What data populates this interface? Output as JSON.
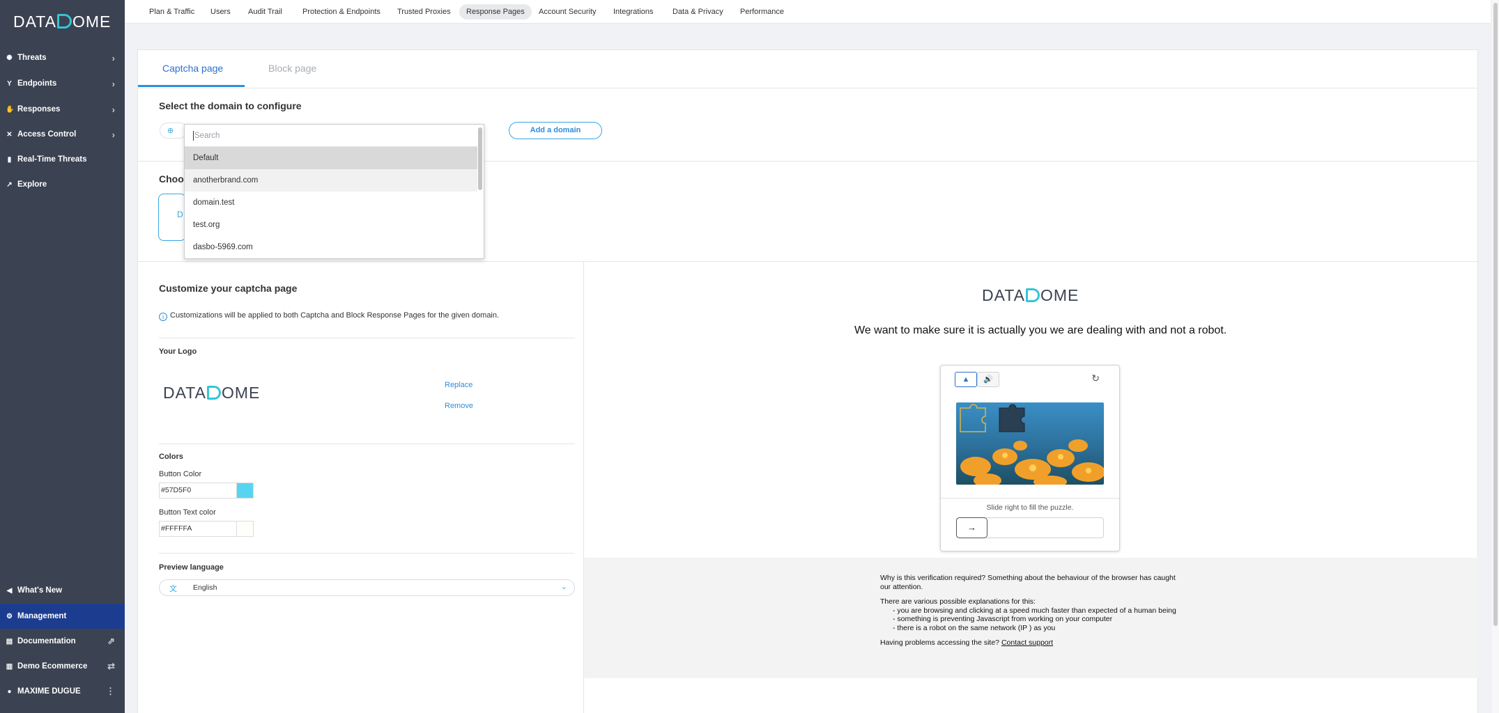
{
  "brand": {
    "logo_left": "DATA",
    "logo_right": "OME",
    "accent": "#35c4d6",
    "sidebar_bg": "#3b4251",
    "active_bg": "#1c3d8f",
    "link": "#2e8ddb"
  },
  "sidebar": {
    "items": [
      {
        "label": "Threats",
        "icon": "threats-icon"
      },
      {
        "label": "Endpoints",
        "icon": "endpoints-icon"
      },
      {
        "label": "Responses",
        "icon": "responses-icon"
      },
      {
        "label": "Access Control",
        "icon": "access-control-icon"
      },
      {
        "label": "Real-Time Threats",
        "icon": "realtime-icon"
      },
      {
        "label": "Explore",
        "icon": "explore-icon"
      }
    ],
    "bottom": [
      {
        "label": "What's New",
        "icon": "megaphone-icon"
      },
      {
        "label": "Management",
        "icon": "gear-icon"
      },
      {
        "label": "Documentation",
        "icon": "document-icon"
      },
      {
        "label": "Demo Ecommerce",
        "icon": "store-icon"
      },
      {
        "label": "MAXIME DUGUE",
        "icon": "user-icon"
      }
    ]
  },
  "topnav": {
    "tabs": [
      "Plan & Traffic",
      "Users",
      "Audit Trail",
      "Protection & Endpoints",
      "Trusted Proxies",
      "Response Pages",
      "Account Security",
      "Integrations",
      "Data & Privacy",
      "Performance"
    ],
    "active": "Response Pages"
  },
  "page": {
    "tabs": {
      "captcha": "Captcha page",
      "block": "Block page"
    },
    "select_domain_title": "Select the domain to configure",
    "add_domain": "Add a domain",
    "choose_title": "Choos",
    "choose_letter": "D"
  },
  "dropdown": {
    "placeholder": "Search",
    "items": [
      "Default",
      "anotherbrand.com",
      "domain.test",
      "test.org",
      "dasbo-5969.com"
    ],
    "selected": "Default",
    "hovered": "anotherbrand.com"
  },
  "customize": {
    "title": "Customize your captcha page",
    "info": "Customizations will be applied to both Captcha and Block Response Pages for the given domain.",
    "logo_label": "Your Logo",
    "replace": "Replace",
    "remove": "Remove",
    "colors_label": "Colors",
    "button_color_label": "Button Color",
    "button_color": "#57D5F0",
    "button_text_color_label": "Button Text color",
    "button_text_color": "#FFFFFA",
    "preview_language_label": "Preview language",
    "preview_language": "English"
  },
  "preview": {
    "message": "We want to make sure it is actually you we are dealing with and not a robot.",
    "slide_text": "Slide right to fill the puzzle.",
    "why": "Why is this verification required? Something about the behaviour of the browser has caught our attention.",
    "reasons_intro": "There are various possible explanations for this:",
    "reasons": [
      "- you are browsing and clicking at a speed much faster than expected of a human being",
      "- something is preventing Javascript from working on your computer",
      "- there is a robot on the same network (IP ) as you"
    ],
    "problems": "Having problems accessing the site?",
    "contact": "Contact support"
  }
}
